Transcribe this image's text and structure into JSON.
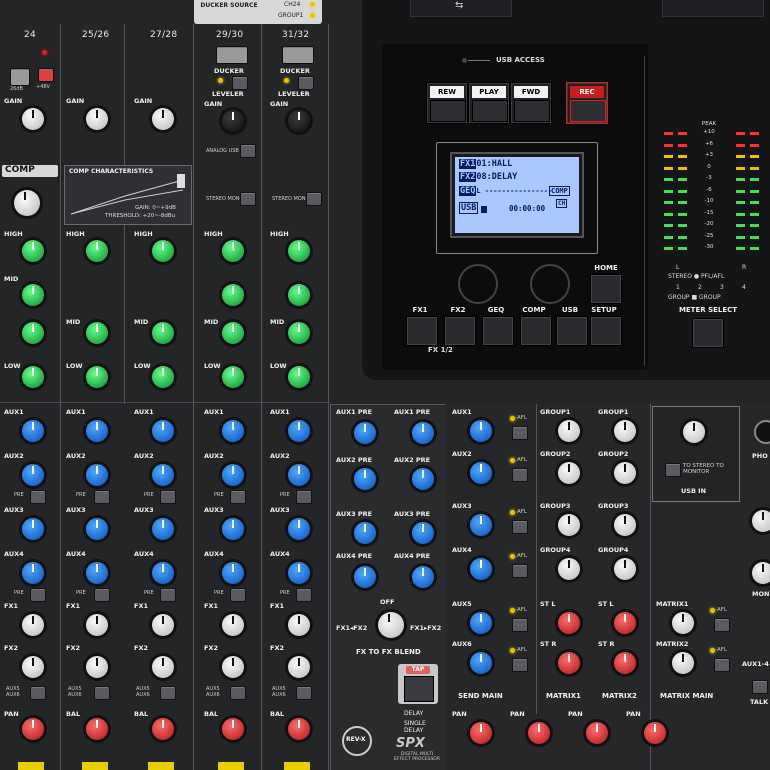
{
  "channels": {
    "ch24": "24",
    "ch2526": "25/26",
    "ch2728": "27/28",
    "ch2930": "29/30",
    "ch3132": "31/32"
  },
  "ducker": {
    "source_label": "DUCKER SOURCE",
    "opt1": "CH24",
    "opt2": "GROUP1",
    "ducker": "DUCKER",
    "leveler": "LEVELER"
  },
  "labels": {
    "gain": "GAIN",
    "comp": "COMP",
    "comp_char": "COMP CHARACTERISTICS",
    "comp_gain": "GAIN: 0~+9dB",
    "comp_thresh": "THRESHOLD: +20~-8dBu",
    "high": "HIGH",
    "mid": "MID",
    "low": "LOW",
    "aux1": "AUX1",
    "aux2": "AUX2",
    "aux3": "AUX3",
    "aux4": "AUX4",
    "pre": "PRE",
    "fx1": "FX1",
    "fx2": "FX2",
    "aux56": "AUX5 AUX6",
    "pan": "PAN",
    "bal": "BAL",
    "phantom": "+48V",
    "pad": "26dB",
    "analog_usb": "ANALOG USB IN",
    "stereo_mono": "STEREO MONO",
    "aux1pre": "AUX1 PRE",
    "aux2pre": "AUX2 PRE",
    "aux3pre": "AUX3 PRE",
    "aux4pre": "AUX4 PRE",
    "off": "OFF",
    "fxblend": "FX TO FX BLEND",
    "fx1fx2": "FX1◂FX2",
    "fx1fx2b": "FX1▸FX2",
    "tap": "TAP",
    "delay": "DELAY",
    "single_delay": "SINGLE DELAY",
    "spx": "SPX",
    "spx_sub": "DIGITAL MULTI EFFECT PROCESSOR",
    "revx": "REV-X",
    "afl": "AFL",
    "send_main": "SEND MAIN",
    "matrix1": "MATRIX1",
    "matrix2": "MATRIX2",
    "matrix_main": "MATRIX MAIN",
    "group1": "GROUP1",
    "group2": "GROUP2",
    "group3": "GROUP3",
    "group4": "GROUP4",
    "st_l": "ST L",
    "st_r": "ST R",
    "aux5": "AUX5",
    "aux6": "AUX6",
    "usb_in": "USB IN",
    "to_stereo": "TO STEREO TO MONITOR",
    "phones": "PHO",
    "moni": "MON",
    "aux14": "AUX1-4",
    "talk": "TALK"
  },
  "usb": {
    "access": "USB ACCESS",
    "rew": "REW",
    "play": "PLAY",
    "fwd": "FWD",
    "rec": "REC",
    "home": "HOME",
    "fx1": "FX1",
    "fx2": "FX2",
    "geq": "GEQ",
    "comp": "COMP",
    "usb": "USB",
    "setup": "SETUP",
    "fx12": "FX 1/2",
    "meter_select": "METER SELECT",
    "usb_symbol": "⇆"
  },
  "lcd": {
    "fx1_tag": "FX1",
    "fx1_val": "01:HALL",
    "fx2_tag": "FX2",
    "fx2_val": "08:DELAY",
    "geq_tag": "GEQ",
    "geq_val": "L ----------------",
    "comp_tag": "COMP",
    "usb_tag": "USB",
    "usb_time": "00:00:00",
    "on_tag": "CH"
  },
  "meter": {
    "peak": "PEAK",
    "scale": [
      "+10",
      "+6",
      "+3",
      "0",
      "-3",
      "-6",
      "-10",
      "-15",
      "-20",
      "-25",
      "-30"
    ],
    "l": "L",
    "r": "R",
    "stereo_pfl": "STEREO ● PFL/AFL",
    "group_nums": [
      "1",
      "2",
      "3",
      "4"
    ],
    "group_sel": "GROUP ■ GROUP"
  }
}
